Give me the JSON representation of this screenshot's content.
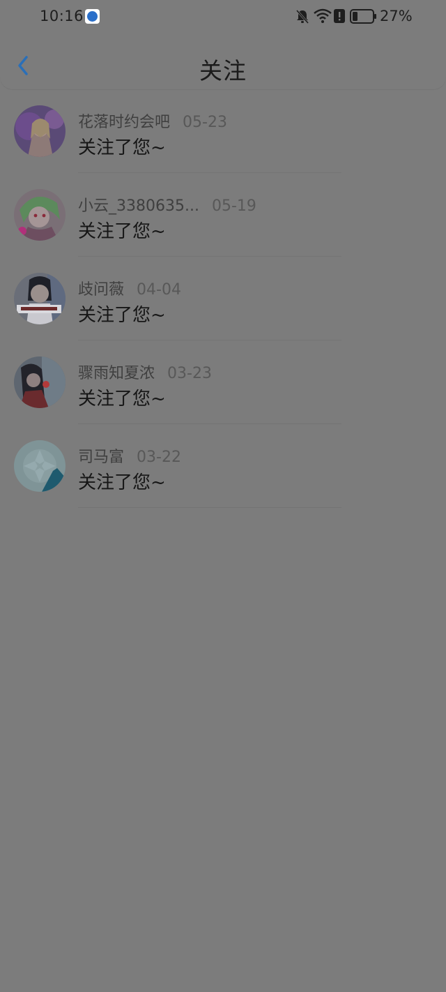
{
  "status_bar": {
    "time": "10:16",
    "battery_percent": "27%",
    "battery_level": 0.27
  },
  "header": {
    "title": "关注"
  },
  "notifications": [
    {
      "name": "花落时约会吧",
      "date": "05-23",
      "message": "关注了您~"
    },
    {
      "name": "小云_3380635...",
      "date": "05-19",
      "message": "关注了您~"
    },
    {
      "name": "歧问薇",
      "date": "04-04",
      "message": "关注了您~"
    },
    {
      "name": "骤雨知夏浓",
      "date": "03-23",
      "message": "关注了您~"
    },
    {
      "name": "司马富",
      "date": "03-22",
      "message": "关注了您~"
    }
  ],
  "colors": {
    "accent": "#2a6fb8",
    "overlay_background": "#7c7c7c"
  }
}
